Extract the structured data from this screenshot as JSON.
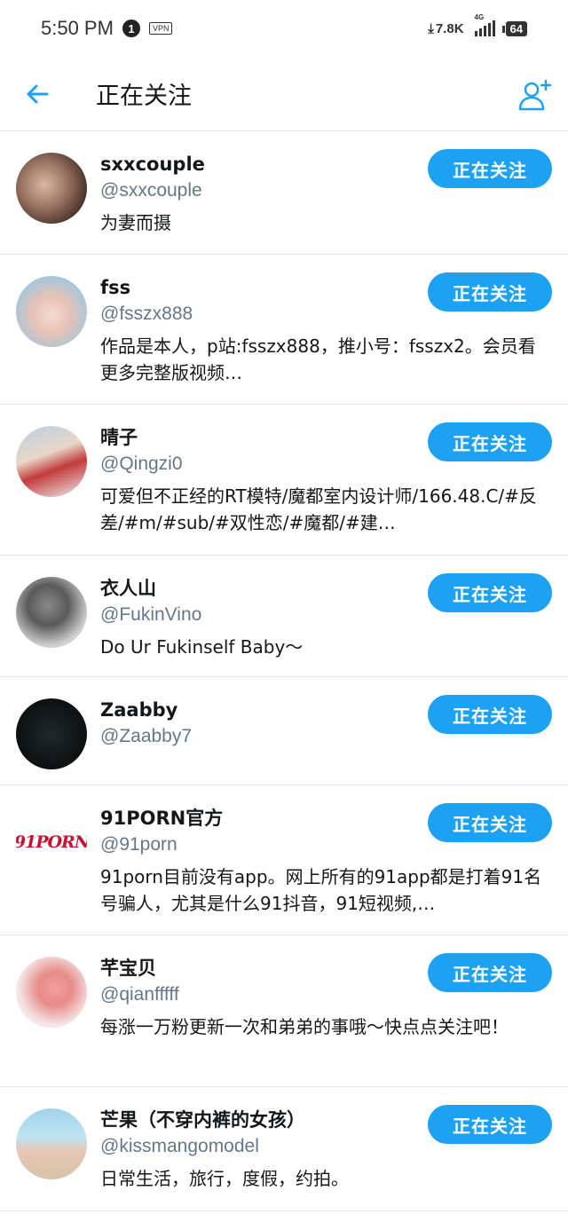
{
  "status_bar": {
    "time": "5:50 PM",
    "notification_count": "1",
    "vpn_label": "VPN",
    "net_speed": "7.8K",
    "network_type": "4G",
    "battery": "64"
  },
  "header": {
    "title": "正在关注",
    "back_icon": "arrow-left-icon",
    "add_icon": "add-user-icon"
  },
  "colors": {
    "accent": "#1da1f2",
    "handle": "#657786",
    "divider": "#e1e8ed"
  },
  "follow_label": "正在关注",
  "users": [
    {
      "name": "sxxcouple",
      "handle": "@sxxcouple",
      "bio": "为妻而摄"
    },
    {
      "name": "fss",
      "handle": "@fsszx888",
      "bio": "作品是本人，p站:fsszx888，推小号：fsszx2。会员看更多完整版视频…"
    },
    {
      "name": "晴子",
      "handle": "@Qingzi0",
      "bio": "可爱但不正经的RT模特/魔都室内设计师/166.48.C/#反差/#m/#sub/#双性恋/#魔都/#建…"
    },
    {
      "name": "衣人山",
      "handle": "@FukinVino",
      "bio": "Do Ur Fukinself Baby～"
    },
    {
      "name": "Zaabby",
      "handle": "@Zaabby7",
      "bio": ""
    },
    {
      "name": "91PORN官方",
      "handle": "@91porn",
      "bio": "91porn目前没有app。网上所有的91app都是打着91名号骗人，尤其是什么91抖音，91短视频,…",
      "avatar_text": "91PORN"
    },
    {
      "name": "芊宝贝",
      "handle": "@qianfffff",
      "bio": "每涨一万粉更新一次和弟弟的事哦～快点点关注吧！"
    },
    {
      "name": "芒果（不穿内裤的女孩）",
      "handle": "@kissmangomodel",
      "bio": "日常生活，旅行，度假，约拍。"
    }
  ]
}
